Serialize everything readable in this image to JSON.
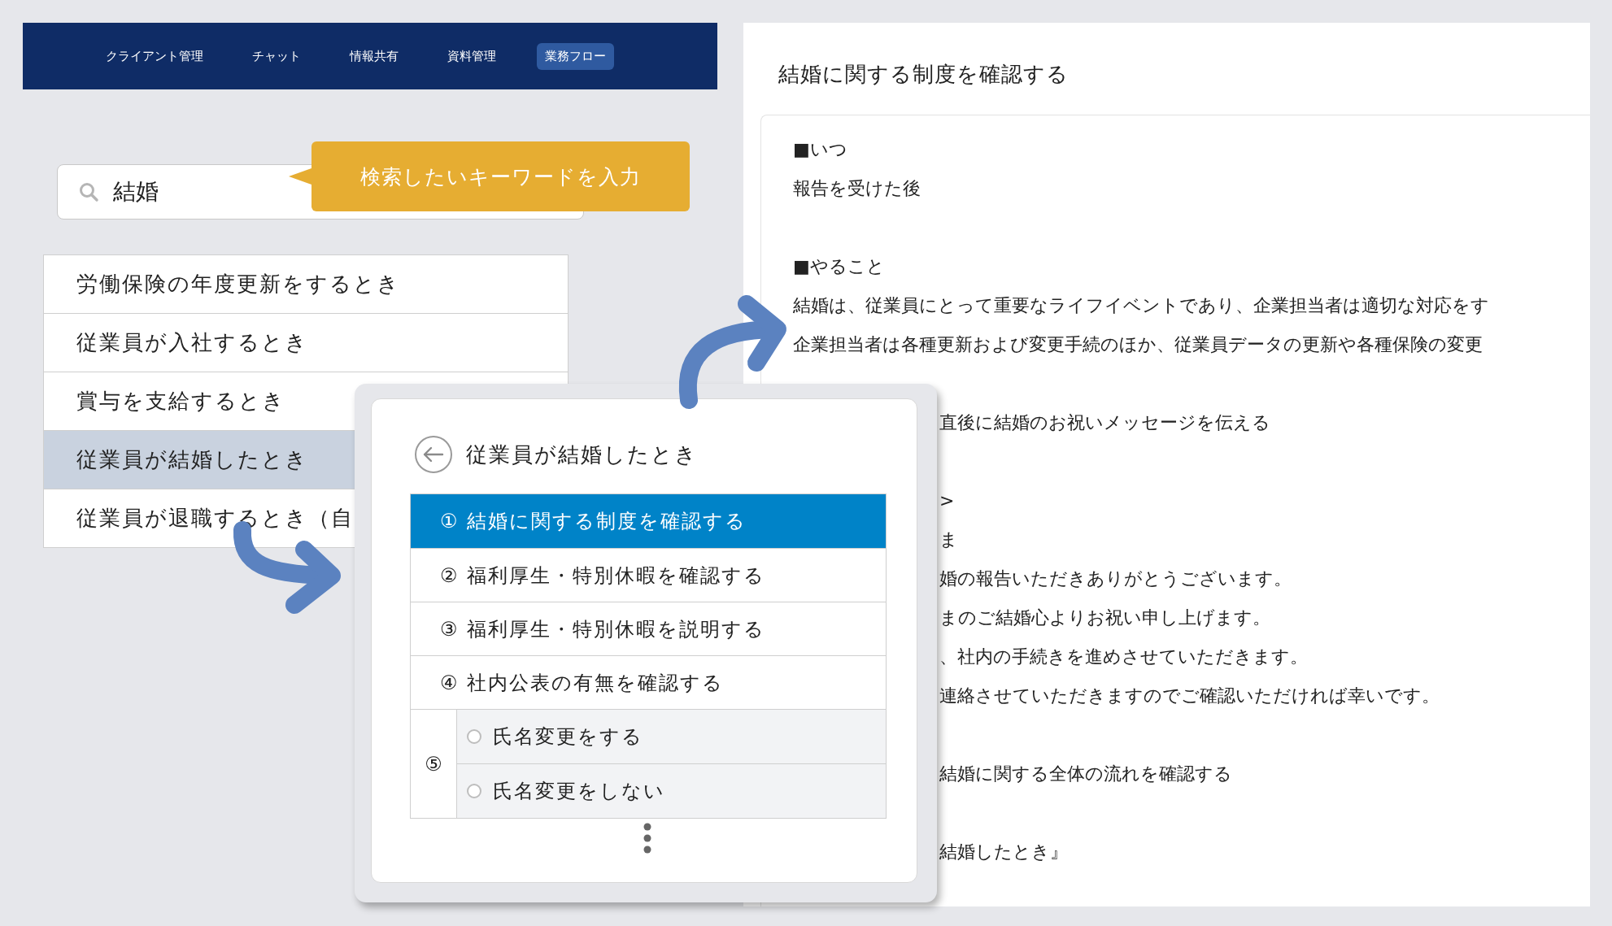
{
  "nav": {
    "tabs": [
      {
        "label": "クライアント管理",
        "selected": false
      },
      {
        "label": "チャット",
        "selected": false
      },
      {
        "label": "情報共有",
        "selected": false
      },
      {
        "label": "資料管理",
        "selected": false
      },
      {
        "label": "業務フロー",
        "selected": true
      }
    ]
  },
  "search": {
    "value": "結婚"
  },
  "tooltip": {
    "text": "検索したいキーワードを入力"
  },
  "results": [
    {
      "label": "労働保険の年度更新をするとき",
      "selected": false
    },
    {
      "label": "従業員が入社するとき",
      "selected": false
    },
    {
      "label": "賞与を支給するとき",
      "selected": false
    },
    {
      "label": "従業員が結婚したとき",
      "selected": true
    },
    {
      "label": "従業員が退職するとき（自",
      "selected": false
    }
  ],
  "flow_popup": {
    "title": "従業員が結婚したとき",
    "steps": [
      {
        "kind": "step",
        "label": "① 結婚に関する制度を確認する",
        "selected": true
      },
      {
        "kind": "step",
        "label": "② 福利厚生・特別休暇を確認する",
        "selected": false
      },
      {
        "kind": "step",
        "label": "③ 福利厚生・特別休暇を説明する",
        "selected": false
      },
      {
        "kind": "step",
        "label": "④ 社内公表の有無を確認する",
        "selected": false
      },
      {
        "kind": "choice",
        "number": "⑤",
        "options": [
          {
            "label": "氏名変更をする",
            "selected": false
          },
          {
            "label": "氏名変更をしない",
            "selected": false
          }
        ]
      }
    ]
  },
  "detail": {
    "title": "結婚に関する制度を確認する",
    "lines": [
      {
        "kind": "line",
        "text": "■いつ"
      },
      {
        "kind": "line",
        "text": "報告を受けた後"
      },
      {
        "kind": "blank"
      },
      {
        "kind": "line",
        "text": "■やること"
      },
      {
        "kind": "line",
        "text": "結婚は、従業員にとって重要なライフイベントであり、企業担当者は適切な対応をす"
      },
      {
        "kind": "line",
        "text": "企業担当者は各種更新および変更手続のほか、従業員データの更新や各種保険の変更"
      },
      {
        "kind": "blank"
      },
      {
        "kind": "covered",
        "text": "直後に結婚のお祝いメッセージを伝える"
      },
      {
        "kind": "blank"
      },
      {
        "kind": "covered",
        "text": ">"
      },
      {
        "kind": "covered",
        "text": "ま"
      },
      {
        "kind": "covered",
        "text": "婚の報告いただきありがとうございます。"
      },
      {
        "kind": "covered",
        "text": "まのご結婚心よりお祝い申し上げます。"
      },
      {
        "kind": "covered",
        "text": "、社内の手続きを進めさせていただきます。"
      },
      {
        "kind": "covered",
        "text": "連絡させていただきますのでご確認いただければ幸いです。"
      },
      {
        "kind": "blank"
      },
      {
        "kind": "covered",
        "text": "結婚に関する全体の流れを確認する"
      },
      {
        "kind": "blank"
      },
      {
        "kind": "covered",
        "text": "結婚したとき』"
      }
    ]
  }
}
